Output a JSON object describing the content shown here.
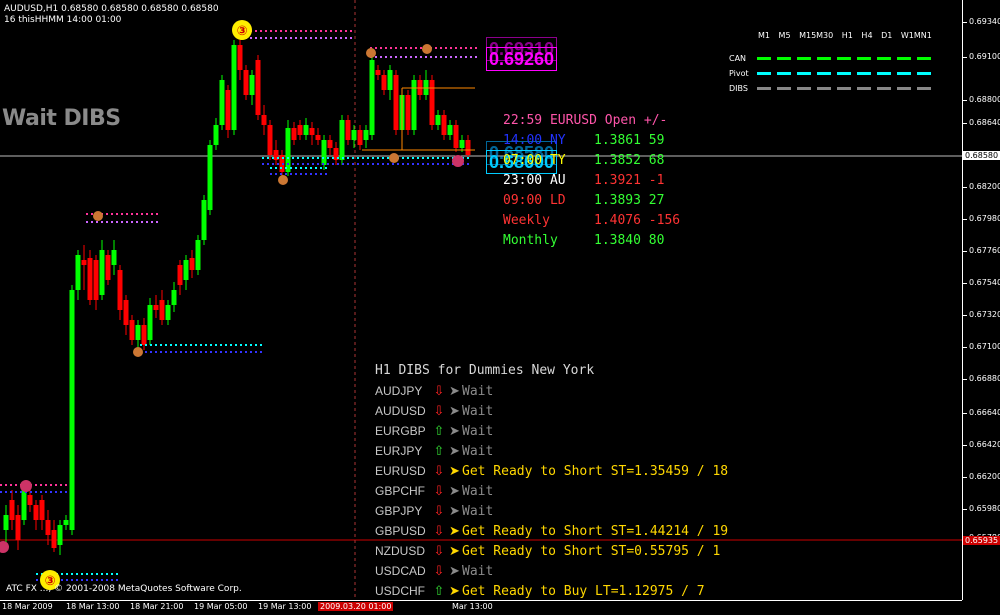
{
  "header": {
    "line1": "AUDUSD,H1  0.68580 0.68580 0.68580 0.68580",
    "line2": "16 thisHHMM 14:00 01:00"
  },
  "wait_label": "Wait DIBS",
  "price_axis": [
    "0.69340",
    "0.69100",
    "0.68800",
    "0.68640",
    "0.68580",
    "0.68420",
    "0.68200",
    "0.67980",
    "0.67760",
    "0.67540",
    "0.67320",
    "0.67100",
    "0.66880",
    "0.66640",
    "0.66420",
    "0.66200",
    "0.65980",
    "0.65935",
    "0.65780"
  ],
  "price_axis_values": [
    0.6934,
    0.691,
    0.688,
    0.6864,
    0.6858,
    0.6842,
    0.682,
    0.6798,
    0.6776,
    0.6754,
    0.6732,
    0.671,
    0.6688,
    0.6664,
    0.6642,
    0.662,
    0.6598,
    0.65935,
    0.6578
  ],
  "time_axis": [
    "18 Mar 2009",
    "18 Mar 13:00",
    "18 Mar 21:00",
    "19 Mar 05:00",
    "19 Mar 13:00",
    "2009.03.20 01:00",
    "Mar 13:00"
  ],
  "copyright": "ATC FX ..., © 2001-2008 MetaQuotes Software Corp.",
  "price_boxes": {
    "upper": "0.69260",
    "upper_shadow": "0.69310",
    "lower": "0.68600",
    "lower_shadow": "0.68580"
  },
  "current_price": "0.68580",
  "red_line_price": "0.65935",
  "legend": {
    "timeframes": "M1 M5 M15M30 H1 H4 D1 W1MN1",
    "rows": [
      {
        "label": "CAN",
        "color_a": "#00ff00",
        "color_b": "#ff0000"
      },
      {
        "label": "Pivot",
        "color_a": "#00ffff",
        "color_b": "#ff00ff"
      },
      {
        "label": "DIBS",
        "color_a": "#888888",
        "color_b": "#888888"
      }
    ]
  },
  "session_panel": [
    {
      "label": "22:59 EURUSD Open +/-",
      "color": "#ff55aa"
    },
    {
      "label": "14:00 NY",
      "value": "1.3861 59",
      "color": "#2233ff",
      "vcolor": "#33ff33"
    },
    {
      "label": "07:00 TY",
      "value": "1.3852 68",
      "color": "#ffff00",
      "vcolor": "#33ff33"
    },
    {
      "label": "23:00 AU",
      "value": "1.3921 -1",
      "color": "#ffffff",
      "vcolor": "#ff3333"
    },
    {
      "label": "09:00 LD",
      "value": "1.3893 27",
      "color": "#ff3333",
      "vcolor": "#33ff33"
    },
    {
      "label": "Weekly",
      "value": "1.4076 -156",
      "color": "#ff3333",
      "vcolor": "#ff3333"
    },
    {
      "label": "Monthly",
      "value": "1.3840 80",
      "color": "#33ff33",
      "vcolor": "#33ff33"
    }
  ],
  "dibs": {
    "title": "H1 DIBS for Dummies New York",
    "rows": [
      {
        "symbol": "AUDJPY",
        "dir": "down",
        "signal": "Wait"
      },
      {
        "symbol": "AUDUSD",
        "dir": "down",
        "signal": "Wait"
      },
      {
        "symbol": "EURGBP",
        "dir": "up",
        "signal": "Wait"
      },
      {
        "symbol": "EURJPY",
        "dir": "up",
        "signal": "Wait"
      },
      {
        "symbol": "EURUSD",
        "dir": "down",
        "signal": "Get Ready to Short ST=1.35459 / 18"
      },
      {
        "symbol": "GBPCHF",
        "dir": "down",
        "signal": "Wait"
      },
      {
        "symbol": "GBPJPY",
        "dir": "down",
        "signal": "Wait"
      },
      {
        "symbol": "GBPUSD",
        "dir": "down",
        "signal": "Get Ready to Short ST=1.44214 / 19"
      },
      {
        "symbol": "NZDUSD",
        "dir": "down",
        "signal": "Get Ready to Short ST=0.55795 / 1"
      },
      {
        "symbol": "USDCAD",
        "dir": "down",
        "signal": "Wait"
      },
      {
        "symbol": "USDCHF",
        "dir": "up",
        "signal": "Get Ready to Buy LT=1.12975 / 7"
      }
    ]
  },
  "colors": {
    "bull": "#00ff00",
    "bear": "#ff0000",
    "wait": "#8a8a8a",
    "ready": "#ffd700",
    "up_arrow": "#33dd33",
    "down_arrow": "#ff2222"
  }
}
